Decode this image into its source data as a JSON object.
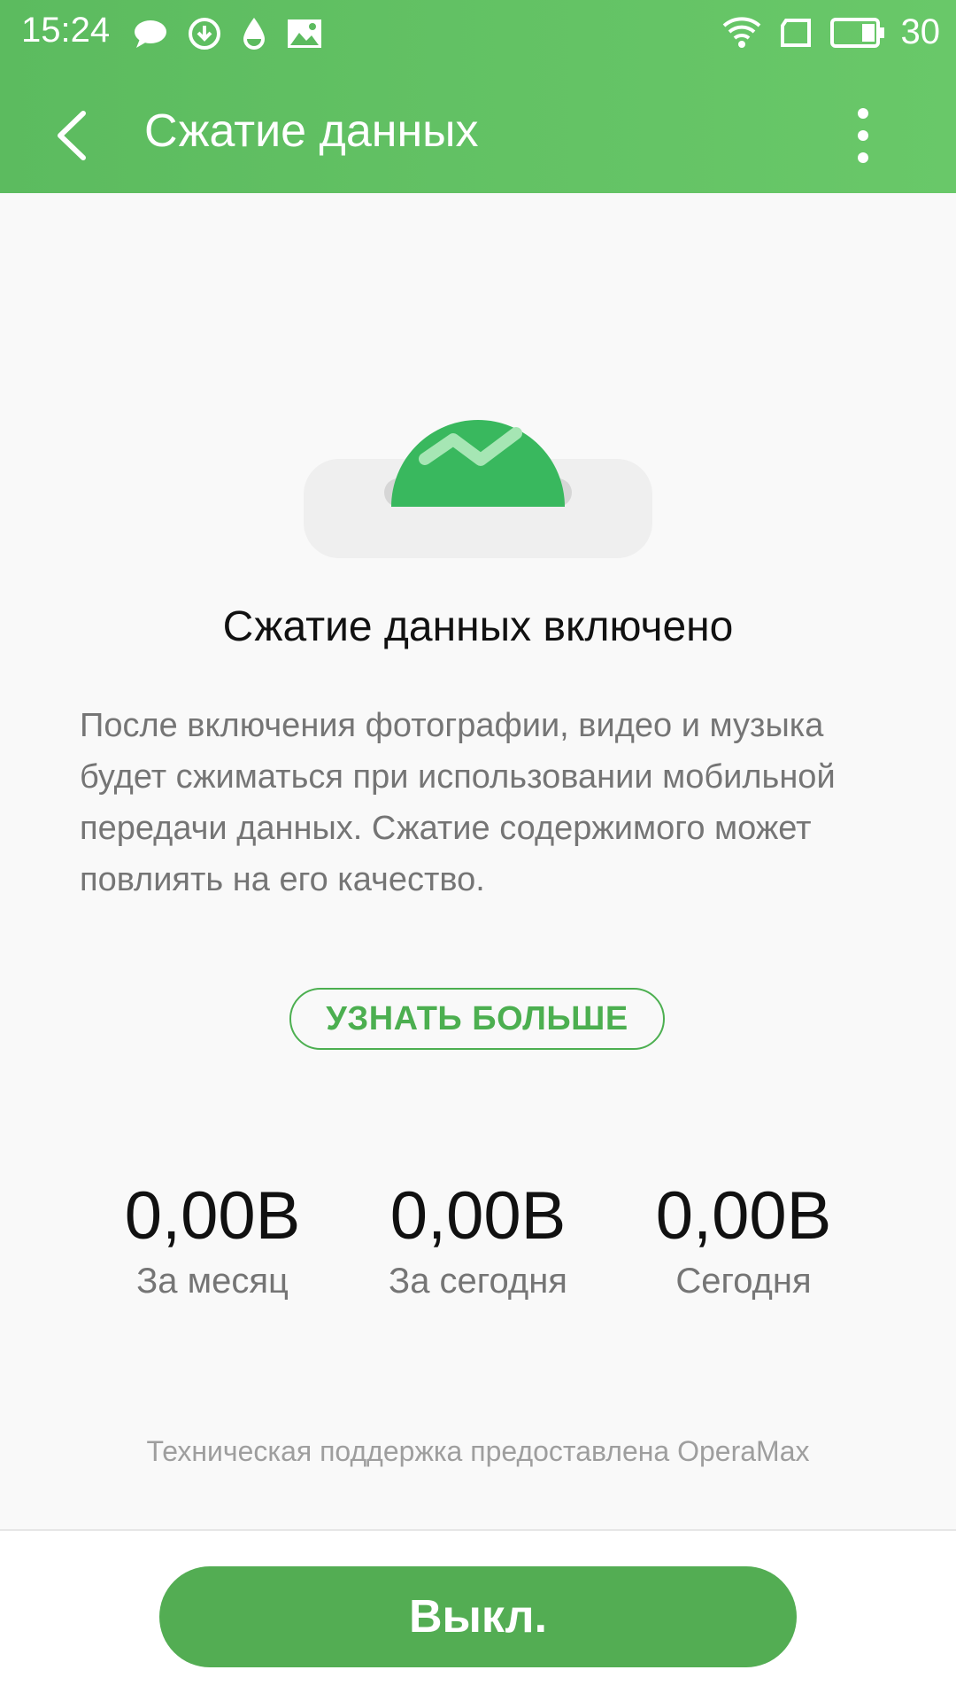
{
  "status_bar": {
    "time": "15:24",
    "battery_level": "30",
    "left_icons": [
      "chat-bubble-icon",
      "download-icon",
      "drop-icon",
      "image-icon"
    ],
    "right_icons": [
      "wifi-icon",
      "sim-icon",
      "battery-icon"
    ]
  },
  "toolbar": {
    "title": "Сжатие данных",
    "back_icon": "back-arrow-icon",
    "menu_icon": "more-vertical-icon"
  },
  "colors": {
    "primary": "#5cbb5f",
    "accent": "#4caf50",
    "button": "#53ad53"
  },
  "main": {
    "title": "Сжатие данных включено",
    "description": "После включения фотографии, видео и музыка будет сжиматься при использовании мобильной передачи данных. Сжатие содержимого может повлиять на его качество.",
    "learn_more_label": "УЗНАТЬ БОЛЬШЕ"
  },
  "stats": [
    {
      "value": "0,00B",
      "label": "За месяц"
    },
    {
      "value": "0,00B",
      "label": "За сегодня"
    },
    {
      "value": "0,00B",
      "label": "Сегодня"
    }
  ],
  "footer_note": "Техническая поддержка предоставлена OperaMax",
  "off_button_label": "Выкл."
}
